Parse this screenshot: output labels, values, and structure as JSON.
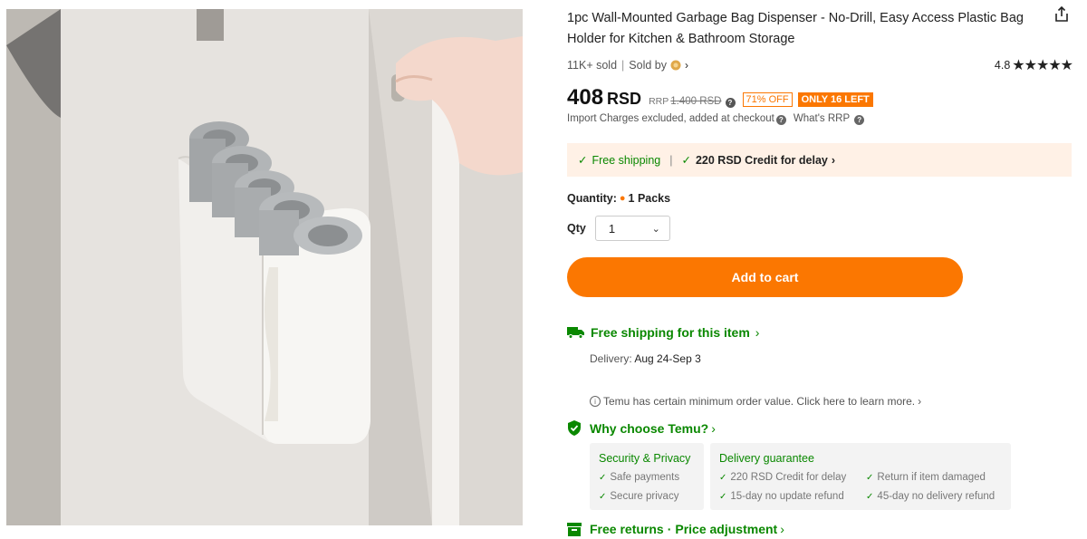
{
  "product": {
    "title": "1pc Wall-Mounted Garbage Bag Dispenser - No-Drill, Easy Access Plastic Bag Holder for Kitchen & Bathroom Storage",
    "sold": "11K+ sold",
    "sold_by_label": "Sold by",
    "rating_value": "4.8",
    "stars": "★★★★★",
    "image_alt": "product-photo-bag-dispenser"
  },
  "price": {
    "value": "408",
    "currency": "RSD",
    "rrp_label": "RRP",
    "rrp_value": "1.400 RSD",
    "discount_badge": "71% OFF",
    "stock_badge": "ONLY 16 LEFT",
    "import_note": "Import Charges excluded, added at checkout",
    "whats_rrp": "What's RRP"
  },
  "shipping_banner": {
    "free_shipping": "Free shipping",
    "credit": "220 RSD Credit for delay"
  },
  "quantity": {
    "label": "Quantity:",
    "packs": "1 Packs",
    "qty_label": "Qty",
    "qty_value": "1"
  },
  "cta": {
    "add_to_cart": "Add to cart"
  },
  "delivery": {
    "free_shipping_item": "Free shipping for this item",
    "delivery_label": "Delivery:",
    "delivery_dates": "Aug 24-Sep 3",
    "min_order": "Temu has certain minimum order value. Click here to learn more."
  },
  "why": {
    "title": "Why choose Temu?",
    "security": {
      "title": "Security & Privacy",
      "items": [
        "Safe payments",
        "Secure privacy"
      ]
    },
    "guarantee": {
      "title": "Delivery guarantee",
      "items": [
        "220 RSD Credit for delay",
        "Return if item damaged",
        "15-day no update refund",
        "45-day no delivery refund"
      ]
    }
  },
  "returns": {
    "part1": "Free returns",
    "part2": "Price adjustment"
  },
  "colors": {
    "accent": "#fb7701",
    "success": "#0a8800",
    "banner_bg": "#fff1e6"
  }
}
